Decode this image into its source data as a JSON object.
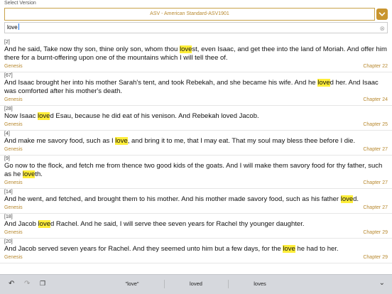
{
  "header": {
    "select_label": "Select Version",
    "version": "ASV - American Standard-ASV1901"
  },
  "search": {
    "value": "love"
  },
  "results": [
    {
      "num": "[2]",
      "parts": [
        {
          "t": "And he said, Take now thy son, thine only son, whom thou ",
          "h": false
        },
        {
          "t": "love",
          "h": true
        },
        {
          "t": "st, even Isaac, and get thee into the land of Moriah. And offer him there for a burnt-offering upon one of the mountains which I will tell thee of.",
          "h": false
        }
      ],
      "book": "Genesis",
      "chapter": "Chapter 22"
    },
    {
      "num": "[67]",
      "parts": [
        {
          "t": "And Isaac brought her into his mother Sarah's tent, and took Rebekah, and she became his wife. And he ",
          "h": false
        },
        {
          "t": "love",
          "h": true
        },
        {
          "t": "d her. And Isaac was comforted after his mother's death.",
          "h": false
        }
      ],
      "book": "Genesis",
      "chapter": "Chapter 24"
    },
    {
      "num": "[28]",
      "parts": [
        {
          "t": "Now Isaac ",
          "h": false
        },
        {
          "t": "love",
          "h": true
        },
        {
          "t": "d Esau, because he did eat of his venison. And Rebekah loved Jacob.",
          "h": false
        }
      ],
      "book": "Genesis",
      "chapter": "Chapter 25"
    },
    {
      "num": "[4]",
      "parts": [
        {
          "t": "And make me savory food, such as I ",
          "h": false
        },
        {
          "t": "love",
          "h": true
        },
        {
          "t": ", and bring it to me, that I may eat. That my soul may bless thee before I die.",
          "h": false
        }
      ],
      "book": "Genesis",
      "chapter": "Chapter 27"
    },
    {
      "num": "[9]",
      "parts": [
        {
          "t": "Go now to the flock, and fetch me from thence two good kids of the goats. And I will make them savory food for thy father, such as he ",
          "h": false
        },
        {
          "t": "love",
          "h": true
        },
        {
          "t": "th.",
          "h": false
        }
      ],
      "book": "Genesis",
      "chapter": "Chapter 27"
    },
    {
      "num": "[14]",
      "parts": [
        {
          "t": "And he went, and fetched, and brought them to his mother. And his mother made savory food, such as his father ",
          "h": false
        },
        {
          "t": "love",
          "h": true
        },
        {
          "t": "d.",
          "h": false
        }
      ],
      "book": "Genesis",
      "chapter": "Chapter 27"
    },
    {
      "num": "[18]",
      "parts": [
        {
          "t": "And Jacob ",
          "h": false
        },
        {
          "t": "love",
          "h": true
        },
        {
          "t": "d Rachel. And he said, I will serve thee seven years for Rachel thy younger daughter.",
          "h": false
        }
      ],
      "book": "Genesis",
      "chapter": "Chapter 29"
    },
    {
      "num": "[20]",
      "parts": [
        {
          "t": "And Jacob served seven years for Rachel. And they seemed unto him but a few days, for the ",
          "h": false
        },
        {
          "t": "love",
          "h": true
        },
        {
          "t": " he had to her.",
          "h": false
        }
      ],
      "book": "Genesis",
      "chapter": "Chapter 29"
    }
  ],
  "keyboard": {
    "suggestions": [
      "\"love\"",
      "loved",
      "loves"
    ]
  },
  "icons": {
    "undo": "undo-icon",
    "redo": "redo-icon",
    "paste": "paste-icon",
    "hide": "keyboard-hide-icon",
    "dropdown": "chevron-down-icon"
  },
  "colors": {
    "accent": "#c9952e",
    "highlight": "#ffee3a"
  }
}
